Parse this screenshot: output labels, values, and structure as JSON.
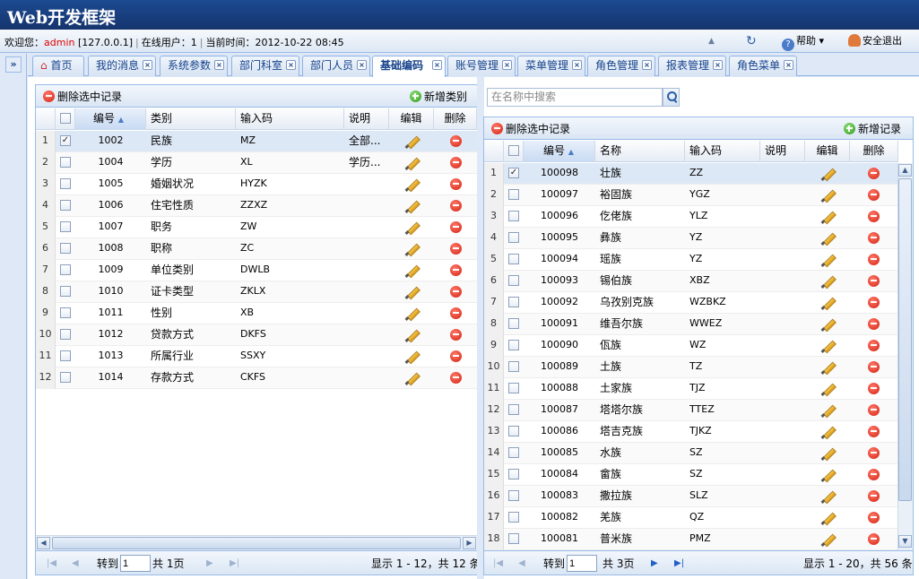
{
  "app": {
    "title": "Web开发框架"
  },
  "info": {
    "welcome": "欢迎您：",
    "user": "admin",
    "ip": "[127.0.0.1]",
    "online_label": "在线用户：",
    "online_count": "1",
    "time_label": "当前时间：",
    "time": "2012-10-22 08:45",
    "help": "帮助",
    "logout": "安全退出"
  },
  "tabs": [
    "首页",
    "我的消息",
    "系统参数",
    "部门科室",
    "部门人员",
    "基础编码",
    "账号管理",
    "菜单管理",
    "角色管理",
    "报表管理",
    "角色菜单"
  ],
  "left": {
    "delete_label": "删除选中记录",
    "add_label": "新增类别",
    "columns": [
      "编号",
      "类别",
      "输入码",
      "说明",
      "编辑",
      "删除"
    ],
    "rows": [
      {
        "n": "1",
        "id": "1002",
        "cat": "民族",
        "code": "MZ",
        "desc": "全部...",
        "checked": true
      },
      {
        "n": "2",
        "id": "1004",
        "cat": "学历",
        "code": "XL",
        "desc": "学历...",
        "checked": false
      },
      {
        "n": "3",
        "id": "1005",
        "cat": "婚姻状况",
        "code": "HYZK",
        "desc": "",
        "checked": false
      },
      {
        "n": "4",
        "id": "1006",
        "cat": "住宅性质",
        "code": "ZZXZ",
        "desc": "",
        "checked": false
      },
      {
        "n": "5",
        "id": "1007",
        "cat": "职务",
        "code": "ZW",
        "desc": "",
        "checked": false
      },
      {
        "n": "6",
        "id": "1008",
        "cat": "职称",
        "code": "ZC",
        "desc": "",
        "checked": false
      },
      {
        "n": "7",
        "id": "1009",
        "cat": "单位类别",
        "code": "DWLB",
        "desc": "",
        "checked": false
      },
      {
        "n": "8",
        "id": "1010",
        "cat": "证卡类型",
        "code": "ZKLX",
        "desc": "",
        "checked": false
      },
      {
        "n": "9",
        "id": "1011",
        "cat": "性别",
        "code": "XB",
        "desc": "",
        "checked": false
      },
      {
        "n": "10",
        "id": "1012",
        "cat": "贷款方式",
        "code": "DKFS",
        "desc": "",
        "checked": false
      },
      {
        "n": "11",
        "id": "1013",
        "cat": "所属行业",
        "code": "SSXY",
        "desc": "",
        "checked": false
      },
      {
        "n": "12",
        "id": "1014",
        "cat": "存款方式",
        "code": "CKFS",
        "desc": "",
        "checked": false
      }
    ],
    "pager": {
      "goto": "转到",
      "page": "1",
      "total_pages": "共 1页",
      "display": "显示 1 - 12，共 12 条"
    }
  },
  "right": {
    "search_placeholder": "在名称中搜索",
    "delete_label": "删除选中记录",
    "add_label": "新增记录",
    "columns": [
      "编号",
      "名称",
      "输入码",
      "说明",
      "编辑",
      "删除"
    ],
    "rows": [
      {
        "n": "1",
        "id": "100098",
        "name": "壮族",
        "code": "ZZ",
        "checked": true
      },
      {
        "n": "2",
        "id": "100097",
        "name": "裕固族",
        "code": "YGZ",
        "checked": false
      },
      {
        "n": "3",
        "id": "100096",
        "name": "仡佬族",
        "code": "YLZ",
        "checked": false
      },
      {
        "n": "4",
        "id": "100095",
        "name": "彝族",
        "code": "YZ",
        "checked": false
      },
      {
        "n": "5",
        "id": "100094",
        "name": "瑶族",
        "code": "YZ",
        "checked": false
      },
      {
        "n": "6",
        "id": "100093",
        "name": "锡伯族",
        "code": "XBZ",
        "checked": false
      },
      {
        "n": "7",
        "id": "100092",
        "name": "乌孜别克族",
        "code": "WZBKZ",
        "checked": false
      },
      {
        "n": "8",
        "id": "100091",
        "name": "维吾尔族",
        "code": "WWEZ",
        "checked": false
      },
      {
        "n": "9",
        "id": "100090",
        "name": "佤族",
        "code": "WZ",
        "checked": false
      },
      {
        "n": "10",
        "id": "100089",
        "name": "土族",
        "code": "TZ",
        "checked": false
      },
      {
        "n": "11",
        "id": "100088",
        "name": "土家族",
        "code": "TJZ",
        "checked": false
      },
      {
        "n": "12",
        "id": "100087",
        "name": "塔塔尔族",
        "code": "TTEZ",
        "checked": false
      },
      {
        "n": "13",
        "id": "100086",
        "name": "塔吉克族",
        "code": "TJKZ",
        "checked": false
      },
      {
        "n": "14",
        "id": "100085",
        "name": "水族",
        "code": "SZ",
        "checked": false
      },
      {
        "n": "15",
        "id": "100084",
        "name": "畲族",
        "code": "SZ",
        "checked": false
      },
      {
        "n": "16",
        "id": "100083",
        "name": "撒拉族",
        "code": "SLZ",
        "checked": false
      },
      {
        "n": "17",
        "id": "100082",
        "name": "羌族",
        "code": "QZ",
        "checked": false
      },
      {
        "n": "18",
        "id": "100081",
        "name": "普米族",
        "code": "PMZ",
        "checked": false
      }
    ],
    "pager": {
      "goto": "转到",
      "page": "1",
      "total_pages": "共 3页",
      "display": "显示 1 - 20，共 56 条"
    }
  }
}
